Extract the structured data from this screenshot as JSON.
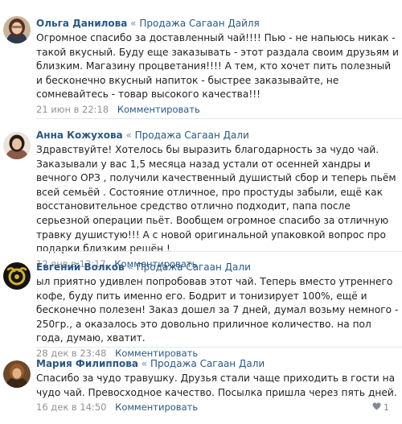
{
  "comments": [
    {
      "author": "Ольга Данилова",
      "separator": "«",
      "group": "Продажа Сагаан Дайля",
      "text": "Огромное спасибо за доставленный чай!!!! Пью - не напьюсь никак - такой вкусный. Буду еще заказывать - этот раздала своим друзьям и близким. Магазину процветания!!!! А тем, кто хочет пить полезный и бесконечно вкусный напиток - быстрее заказывайте, не сомневайтесь - товар высокого качества!!!",
      "date": "21 июн в 22:18",
      "reply": "Комментировать"
    },
    {
      "author": "Анна Кожухова",
      "separator": "«",
      "group": "Продажа Сагаан Дали",
      "text": "Здравствуйте! Хотелось бы выразить благодарность за чудо чай. Заказывали у вас 1,5 месяца назад устали от осенней хандры и вечного ОРЗ , получили качественный душистый сбор и теперь пьём всей семьёй . Состояние отличное, про простуды забыли, ещё как восстановительное средство отлично подходит, папа после серьезной операции пьёт. Вообщем огромное спасибо за отличную травку душистую!!! А с новой оригинальной упаковкой вопрос про подарки близким решён !",
      "date": "12 янв в 13:17",
      "reply": "Комментировать"
    },
    {
      "author": "Евгений Волков",
      "separator": "«",
      "group": "Продажа Сагаан Дали",
      "text": "ыл приятно удивлен попробовав этот чай. Теперь вместо утреннего кофе, буду пить именно его. Бодрит и тонизирует 100%, ещё и бесконечно полезен! Заказ дошел за 7 дней, думал возьму немного - 250гр., а оказалось это довольно приличное количество. на пол года, думаю, хватит.",
      "date": "28 дек в 23:48",
      "reply": "Комментировать"
    },
    {
      "author": "Мария Филиппова",
      "separator": "«",
      "group": "Продажа Сагаан Дали",
      "text": "Спасибо за чудо травушку. Друзья стали чаще приходить в гости на чудо чай. Превосходное качество. Посылка пришла через пять дней.",
      "date": "16 дек в 14:50",
      "reply": "Комментировать",
      "likes": "1"
    }
  ],
  "colors": {
    "author": "#2a5885",
    "date": "#939393",
    "divider": "#e7e8ec"
  }
}
